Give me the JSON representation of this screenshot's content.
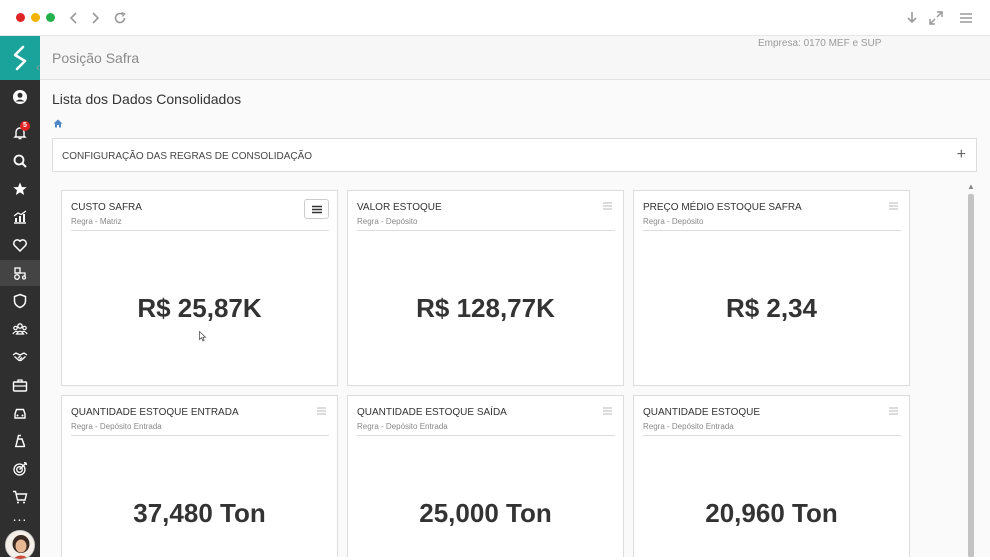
{
  "browser": {
    "dots": [
      "#e02424",
      "#f2b400",
      "#22b14c"
    ],
    "icons": [
      "back-icon",
      "forward-icon",
      "reload-icon",
      "download-icon",
      "expand-icon",
      "menu-icon"
    ]
  },
  "brand": {
    "accent": "#1aa39a",
    "sidebar_bg": "#2f2f2f"
  },
  "sidebar": {
    "notification_count": "5",
    "more_label": "...",
    "icons": [
      "user-circle-icon",
      "bell-icon",
      "search-icon",
      "star-icon",
      "chart-icon",
      "heart-icon",
      "tractor-icon",
      "shield-icon",
      "group-icon",
      "handshake-icon",
      "briefcase-icon",
      "car-icon",
      "bank-icon",
      "target-icon",
      "cart-icon"
    ]
  },
  "header": {
    "page_title": "Posição Safra",
    "company": "Empresa: 0170 MEF e SUP"
  },
  "main": {
    "list_title": "Lista dos Dados Consolidados",
    "config_label": "CONFIGURAÇÃO DAS REGRAS DE CONSOLIDAÇÃO",
    "config_action": "+"
  },
  "cards": [
    {
      "title": "CUSTO SAFRA",
      "subtitle": "Regra - Matriz",
      "value": "R$ 25,87K"
    },
    {
      "title": "VALOR ESTOQUE",
      "subtitle": "Regra - Depósito",
      "value": "R$ 128,77K"
    },
    {
      "title": "PREÇO MÉDIO ESTOQUE SAFRA",
      "subtitle": "Regra - Depósito",
      "value": "R$ 2,34"
    },
    {
      "title": "QUANTIDADE ESTOQUE ENTRADA",
      "subtitle": "Regra - Depósito Entrada",
      "value": "37,480 Ton"
    },
    {
      "title": "QUANTIDADE ESTOQUE SAÍDA",
      "subtitle": "Regra - Depósito Entrada",
      "value": "25,000 Ton"
    },
    {
      "title": "QUANTIDADE ESTOQUE",
      "subtitle": "Regra - Depósito Entrada",
      "value": "20,960 Ton"
    }
  ]
}
